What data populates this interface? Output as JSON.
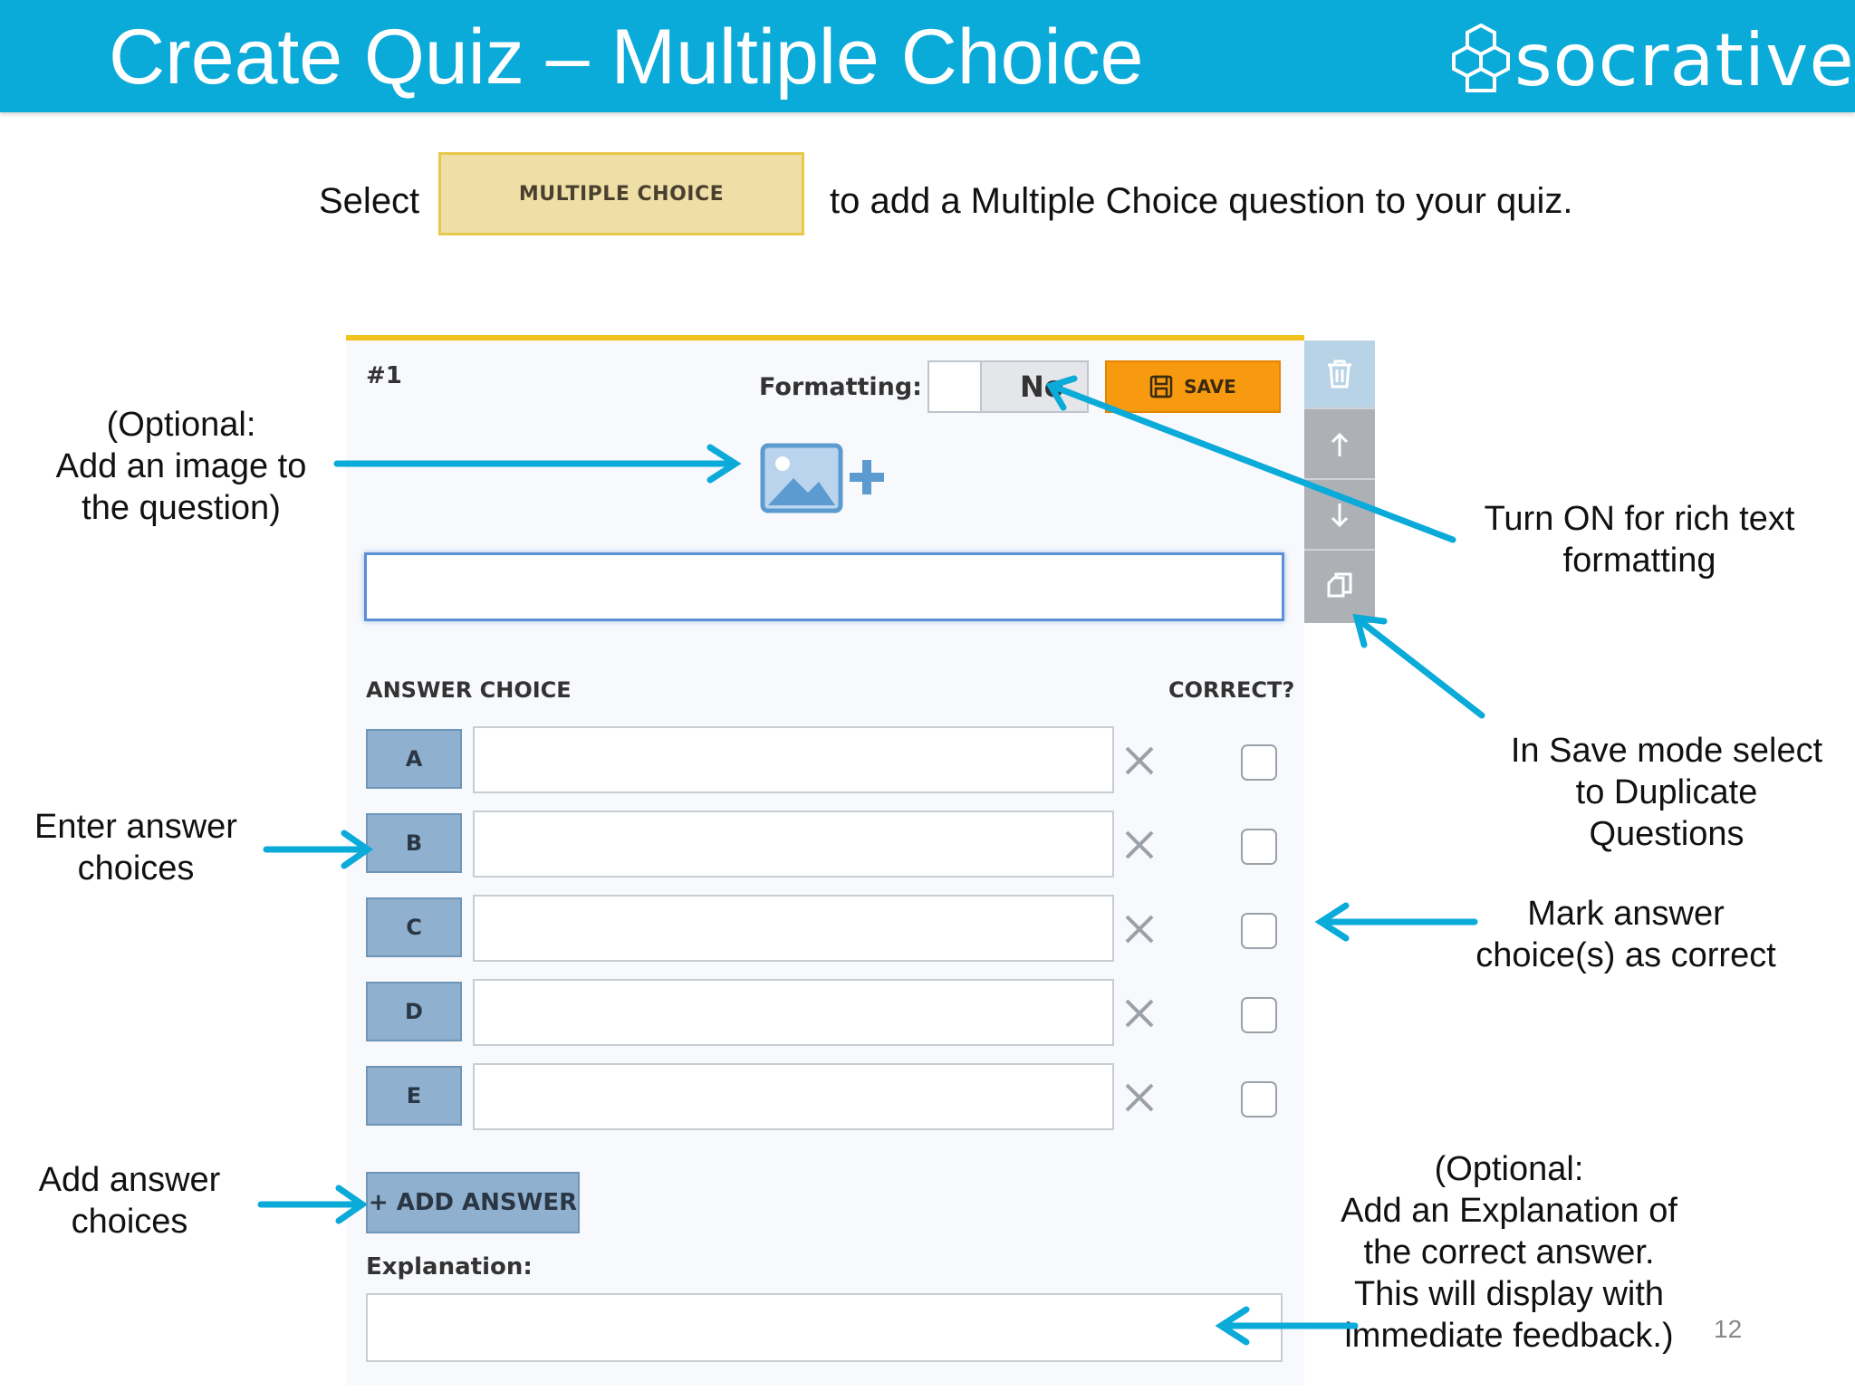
{
  "header": {
    "title": "Create Quiz – Multiple Choice",
    "logo_text": "socrative",
    "bg_color": "#0aaad9"
  },
  "instruction": {
    "prefix": "Select",
    "button_label": "MULTIPLE CHOICE",
    "suffix": "to add a Multiple Choice question to your quiz."
  },
  "card": {
    "question_number": "#1",
    "formatting_label": "Formatting:",
    "formatting_state": "No",
    "save_label": "SAVE",
    "answer_choice_header": "ANSWER CHOICE",
    "correct_header": "CORRECT?",
    "answers": [
      {
        "letter": "A"
      },
      {
        "letter": "B"
      },
      {
        "letter": "C"
      },
      {
        "letter": "D"
      },
      {
        "letter": "E"
      }
    ],
    "add_answer_label": "+ ADD ANSWER",
    "explanation_label": "Explanation:",
    "side_icons": [
      "trash-icon",
      "arrow-up-icon",
      "arrow-down-icon",
      "duplicate-icon"
    ]
  },
  "annotations": {
    "optional_image": [
      "(Optional:",
      "Add an image to",
      "the question)"
    ],
    "rich_text": [
      "Turn ON for rich text",
      "formatting"
    ],
    "duplicate": [
      "In Save mode select",
      "to Duplicate",
      "Questions"
    ],
    "enter_answers": [
      "Enter answer",
      "choices"
    ],
    "mark_correct": [
      "Mark answer",
      "choice(s) as correct"
    ],
    "add_answers": [
      "Add answer",
      "choices"
    ],
    "explanation": [
      "(Optional:",
      "Add an Explanation of",
      "the correct answer.",
      "This will display with",
      "immediate feedback.)"
    ]
  },
  "page_number": "12",
  "colors": {
    "accent_blue": "#0aaad9",
    "save_orange": "#f79a0f",
    "mc_button_fill": "#efdfa6",
    "card_top_border": "#f0c21b",
    "answer_letter_fill": "#8fb1cf"
  }
}
